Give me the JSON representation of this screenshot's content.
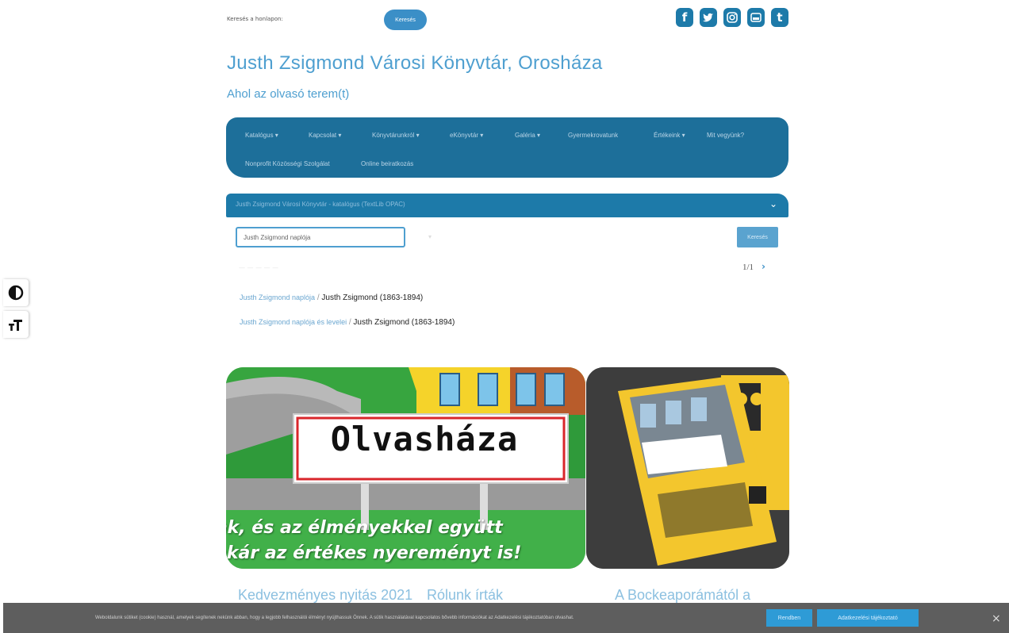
{
  "top": {
    "search_label": "Keresés a honlapon:",
    "search_placeholder": "",
    "search_button": "Keresés"
  },
  "social": {
    "icons": [
      "facebook-icon",
      "twitter-icon",
      "instagram-icon",
      "youtube-icon",
      "tumblr-icon"
    ],
    "color": "#1d7aa9"
  },
  "site": {
    "title": "Justh Zsigmond Városi Könyvtár, Orosháza",
    "subtitle": "Ahol az olvasó terem(t)"
  },
  "nav": {
    "items": [
      "Katalógus ▾",
      "Kapcsolat ▾",
      "Könyvtárunkról ▾",
      "eKönyvtár ▾",
      "Galéria ▾",
      "Gyermekrovatunk",
      "Értékeink ▾",
      "Mit vegyünk?",
      "Nonprofit Közösségi Szolgálat",
      "Online beiratkozás"
    ],
    "background": "#1d6f9a"
  },
  "catalog": {
    "header": "Justh Zsigmond Városi Könyvtár - katalógus (TextLib OPAC)",
    "search_value": "Justh Zsigmond naplója",
    "search_button": "Keresés",
    "pager": "1/1",
    "results": [
      {
        "title": "Justh Zsigmond naplója",
        "separator": "/",
        "author": "Justh Zsigmond (1863-1894)"
      },
      {
        "title": "Justh Zsigmond naplója és levelei",
        "separator": "/",
        "author": "Justh Zsigmond (1863-1894)"
      }
    ]
  },
  "accessibility": {
    "contrast_icon": "contrast-icon",
    "text_size_icon": "text-size-icon"
  },
  "banner": {
    "sign": "Olvasháza",
    "slogan_line1": "nk, és az élményekkel együtt",
    "slogan_line2": "akár az értékes nyereményt is!"
  },
  "teasers": [
    "Kedvezményes nyitás 2021",
    "Rólunk írták",
    "A Bockeaporámától a"
  ],
  "cookie": {
    "text": "Weboldalunk sütiket (cookie) használ, amelyek segítenek nekünk abban, hogy a legjobb felhasználói élményt nyújthassuk Önnek. A sütik használatával kapcsolatos bővebb információkat az Adatkezelési tájékoztatóban olvashat.",
    "ok_button": "Rendben",
    "more_button": "Adatkezelési tájékoztató",
    "close": "×"
  }
}
